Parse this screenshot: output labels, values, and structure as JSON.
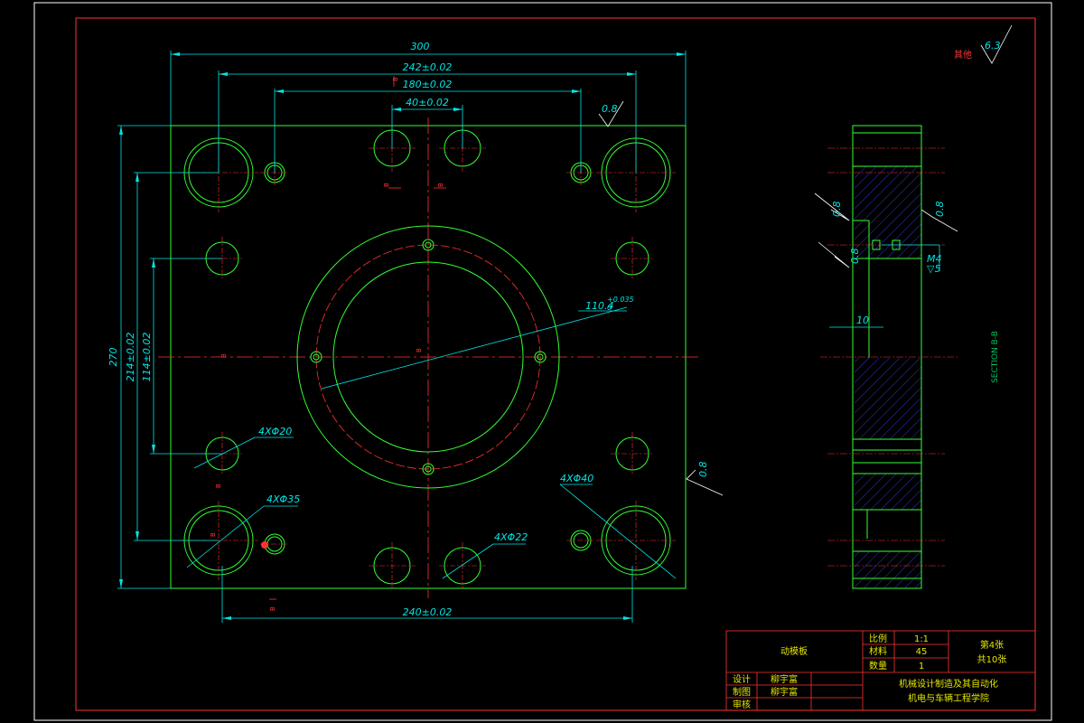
{
  "colors": {
    "background": "#000000",
    "border": "#ffffff",
    "frame": "#ff3333",
    "outline": "#33ff33",
    "centerline": "#ff3333",
    "dimension": "#00e5e5",
    "hatch": "#3333cc",
    "titleblock_text": "#e6e600"
  },
  "dimensions": {
    "overall_width": "300",
    "width_242": "242±0.02",
    "width_180": "180±0.02",
    "width_40": "40±0.02",
    "width_240": "240±0.02",
    "height_270": "270",
    "height_214": "214±0.02",
    "height_114": "114±0.02",
    "bore": "110.4",
    "bore_tol": "+0.035",
    "bore_tol_low": "0",
    "holes_20": "4XΦ20",
    "holes_35": "4XΦ35",
    "holes_40": "4XΦ40",
    "holes_22": "4XΦ22"
  },
  "surface_roughness": {
    "general_label": "其他",
    "general_value": "6.3",
    "top": "0.8",
    "right": "0.8",
    "side_1": "0.8",
    "side_2": "0.8",
    "side_3": "0.8"
  },
  "side_view": {
    "thread": "M4",
    "depth": "▽5",
    "offset": "10",
    "section_label": "SECTION B-B"
  },
  "section_marks": {
    "b": "B"
  },
  "title_block": {
    "part_name": "动模板",
    "scale_label": "比例",
    "scale_value": "1:1",
    "material_label": "材料",
    "material_value": "45",
    "qty_label": "数量",
    "qty_value": "1",
    "sheet_no": "第4张",
    "sheet_total": "共10张",
    "design_label": "设计",
    "design_name": "柳宇富",
    "drawing_label": "制图",
    "drawing_name": "柳宇富",
    "review_label": "审核",
    "course": "机械设计制造及其自动化",
    "school": "机电与车辆工程学院"
  }
}
